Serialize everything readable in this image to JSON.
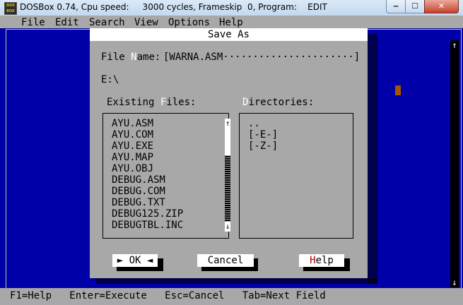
{
  "window": {
    "caption": "DOSBox 0.74, Cpu speed:     3000 cycles, Frameskip  0, Program:    EDIT",
    "icon_text": "DOS BOX",
    "buttons": {
      "minimize": "‒",
      "maximize": "☐",
      "close": "✕"
    }
  },
  "menu": [
    "File",
    "Edit",
    "Search",
    "View",
    "Options",
    "Help"
  ],
  "status_bar": "F1=Help   Enter=Execute   Esc=Cancel   Tab=Next Field",
  "dialog": {
    "title": "Save As",
    "file_name_label_pre": "File ",
    "file_name_label_hot": "N",
    "file_name_label_post": "ame:",
    "file_name_value": "[WARNA.ASM······················]",
    "current_path": "E:\\",
    "existing_files_label_pre": "Existing ",
    "existing_files_label_hot": "F",
    "existing_files_label_post": "iles:",
    "directories_label_hot": "D",
    "directories_label_post": "irectories:",
    "files": [
      "AYU.ASM",
      "AYU.COM",
      "AYU.EXE",
      "AYU.MAP",
      "AYU.OBJ",
      "DEBUG.ASM",
      "DEBUG.COM",
      "DEBUG.TXT",
      "DEBUG125.ZIP",
      "DEBUGTBL.INC"
    ],
    "directories": [
      "..",
      "[-E-]",
      "[-Z-]"
    ],
    "ok_label": "OK",
    "cancel_label": "Cancel",
    "help_label_hot": "H",
    "help_label_post": "elp"
  },
  "icons": {
    "scroll_up": "↑",
    "scroll_down": "↓"
  },
  "colors": {
    "dos_blue": "#0000a8",
    "dialog_gray": "#a8a8a8",
    "cursor": "#a85400"
  }
}
